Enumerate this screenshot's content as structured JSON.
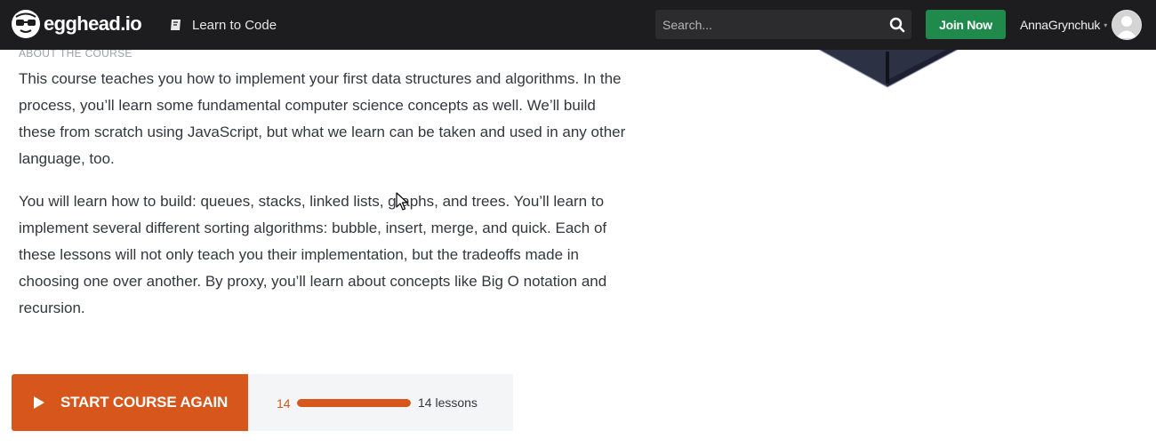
{
  "app": {
    "logo_text": "egghead.io",
    "colors": {
      "navbar": "#1d1d1f",
      "accent": "#d6561b",
      "join": "#1f8a4c"
    }
  },
  "nav": {
    "learn_link": "Learn to Code",
    "learn_icon": "book-icon",
    "search": {
      "placeholder": "Search...",
      "value": "",
      "icon": "search-icon"
    },
    "join_label": "Join Now",
    "user": {
      "name": "AnnaGrynchuk",
      "caret": "▾",
      "avatar_icon": "avatar-icon"
    }
  },
  "about": {
    "label": "ABOUT THE COURSE",
    "paragraphs": [
      "This course teaches you how to implement your first data structures and algorithms. In the process, you’ll learn some fundamental computer science concepts as well. We’ll build these from scratch using JavaScript, but what we learn can be taken and used in any other language, too.",
      "You will learn how to build: queues, stacks, linked lists, graphs, and trees. You’ll learn to implement several different sorting algorithms: bubble, insert, merge, and quick. Each of these lessons will not only teach you their implementation, but the tradeoffs made in choosing one over another. By proxy, you’ll learn about concepts like Big O notation and recursion."
    ]
  },
  "course": {
    "start_label": "START COURSE AGAIN",
    "start_icon": "play-icon",
    "completed": "14",
    "total_label": "14 lessons",
    "progress_fraction": 1.0
  }
}
